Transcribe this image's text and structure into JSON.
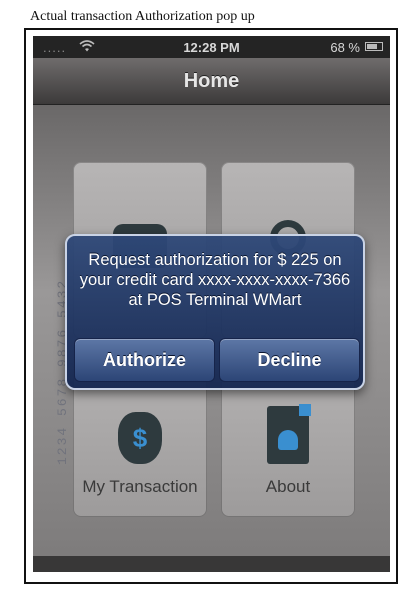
{
  "caption": "Actual transaction Authorization pop up",
  "status_bar": {
    "signal": ".....",
    "time": "12:28 PM",
    "battery": "68 %"
  },
  "nav": {
    "title": "Home"
  },
  "tiles": [
    {
      "label": "",
      "icon": "phone-icon"
    },
    {
      "label": "",
      "icon": "lock-icon"
    },
    {
      "label": "My Transaction",
      "icon": "money-bag-icon"
    },
    {
      "label": "About",
      "icon": "document-person-icon"
    }
  ],
  "money_symbol": "$",
  "side_strip_text": "1234 5678 9876 5432",
  "alert": {
    "message": "Request authorization for $ 225 on your credit card xxxx-xxxx-xxxx-7366 at POS Terminal WMart",
    "authorize_label": "Authorize",
    "decline_label": "Decline"
  }
}
